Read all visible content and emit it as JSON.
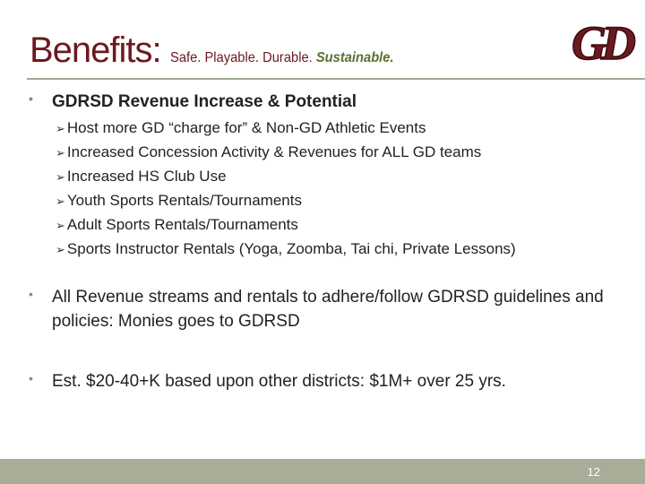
{
  "title": {
    "main": "Benefits:",
    "sub_plain": "Safe. Playable. Durable.",
    "sub_emphasis": "Sustainable."
  },
  "logo": {
    "text": "GD"
  },
  "bullets": [
    {
      "text": "GDRSD Revenue Increase & Potential"
    },
    {
      "text": "All Revenue streams and rentals to adhere/follow GDRSD guidelines and policies: Monies goes to GDRSD"
    },
    {
      "text": "Est. $20-40+K based upon other districts: $1M+ over 25 yrs."
    }
  ],
  "sub_items": [
    "Host more GD “charge for” & Non-GD Athletic Events",
    "Increased Concession Activity & Revenues for ALL GD teams",
    "Increased HS Club Use",
    "Youth Sports Rentals/Tournaments",
    "Adult Sports Rentals/Tournaments",
    "Sports Instructor Rentals (Yoga, Zoomba, Tai chi, Private Lessons)"
  ],
  "page_number": "12",
  "colors": {
    "title": "#6b1a1f",
    "emphasis": "#5a7030",
    "footer": "#a8ad98",
    "rule": "#9fa994"
  }
}
